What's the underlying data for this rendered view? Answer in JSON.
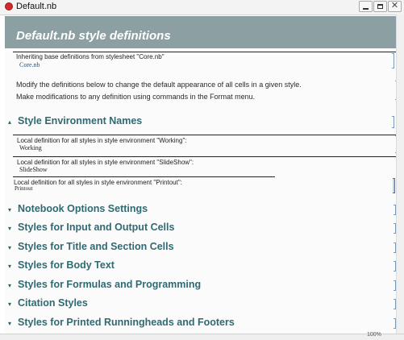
{
  "window": {
    "title": "Default.nb"
  },
  "header": {
    "title": "Default.nb  style definitions"
  },
  "stylesheet_note": {
    "label": "Inheriting base definitions from stylesheet \"Core.nb\"",
    "link": "Core.nb"
  },
  "instructions": {
    "line1": "Modify the definitions below to change the default appearance of all cells in a given style.",
    "line2": "Make modifications to any definition using commands in the Format menu."
  },
  "environment_section": {
    "title": "Style Environment Names",
    "expanded": true,
    "definitions": [
      {
        "label": "Local definition for all styles in style environment \"Working\":",
        "value": "Working"
      },
      {
        "label": "Local definition for all styles in style environment \"SlideShow\":",
        "value": "SlideShow"
      },
      {
        "label": "Local definition for all styles in style environment \"Printout\":",
        "value": "Printout"
      }
    ]
  },
  "sections": [
    {
      "title": "Notebook Options Settings"
    },
    {
      "title": "Styles for Input and Output Cells"
    },
    {
      "title": "Styles for Title and Section Cells"
    },
    {
      "title": "Styles for Body Text"
    },
    {
      "title": "Styles for Formulas and Programming"
    },
    {
      "title": "Citation Styles"
    },
    {
      "title": "Styles for Printed Runningheads and Footers"
    }
  ],
  "status": {
    "zoom": "100%"
  },
  "colors": {
    "header_band": "#8ca0a3",
    "section_title": "#2f6a73",
    "cell_bracket": "#7a98b8"
  }
}
